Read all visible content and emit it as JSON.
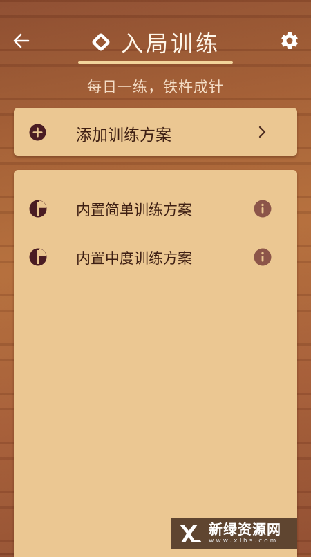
{
  "header": {
    "title": "入局训练",
    "subtitle": "每日一练，铁杵成针",
    "back_icon": "arrow-left-icon",
    "settings_icon": "gear-icon",
    "title_icon": "diamond-icon"
  },
  "add_plan": {
    "label": "添加训练方案",
    "icon": "plus-circle-icon",
    "chevron": "chevron-right-icon"
  },
  "plans": [
    {
      "label": "内置简单训练方案",
      "icon": "pie-icon",
      "info_icon": "info-icon"
    },
    {
      "label": "内置中度训练方案",
      "icon": "pie-icon",
      "info_icon": "info-icon"
    }
  ],
  "watermark": {
    "main": "新绿资源网",
    "sub": "www.xlhs.com"
  },
  "colors": {
    "card_bg": "#ebc792",
    "text_dark": "#3e1f13",
    "icon_dark": "#4a1c23",
    "info_brown": "#8c5549",
    "accent_underline": "#f2d49b",
    "title_white": "#fff7ea"
  }
}
